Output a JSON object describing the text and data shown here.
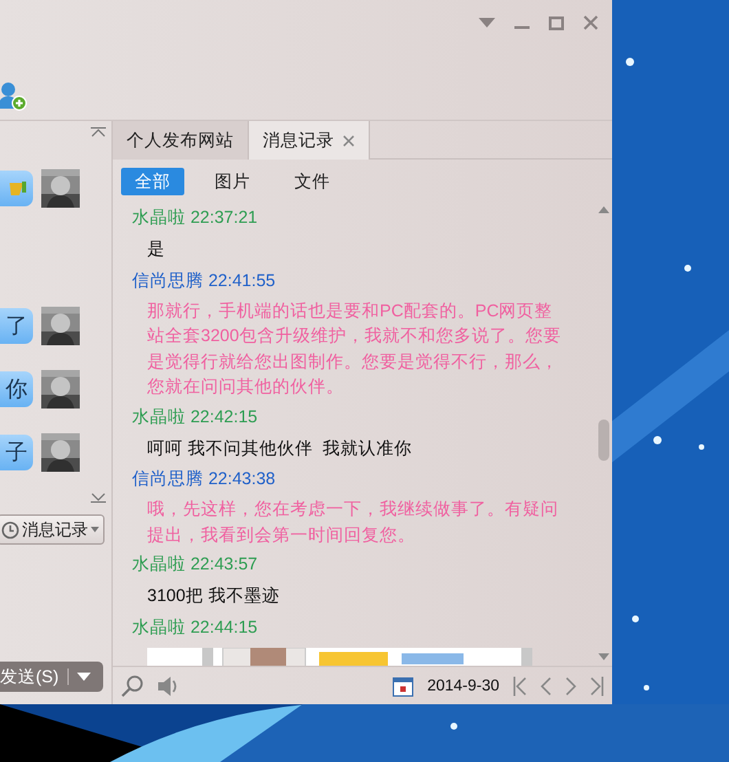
{
  "left_panel": {
    "bubbles": [
      {
        "kind": "icon"
      },
      {
        "kind": "text",
        "text": "了"
      },
      {
        "kind": "text",
        "text": "你"
      },
      {
        "kind": "text",
        "text": "子"
      }
    ],
    "history_button": "消息记录",
    "send_button": "发送(S)"
  },
  "tabs": [
    {
      "label": "个人发布网站",
      "selected": false,
      "closable": false
    },
    {
      "label": "消息记录",
      "selected": true,
      "closable": true
    }
  ],
  "filters": [
    {
      "label": "全部",
      "selected": true
    },
    {
      "label": "图片",
      "selected": false
    },
    {
      "label": "文件",
      "selected": false
    }
  ],
  "messages": [
    {
      "sender": "水晶啦",
      "time": "22:37:21",
      "kind": "self",
      "text": "是"
    },
    {
      "sender": "信尚思腾",
      "time": "22:41:55",
      "kind": "peer",
      "text": "那就行，手机端的话也是要和PC配套的。PC网页整站全套3200包含升级维护，我就不和您多说了。您要是觉得行就给您出图制作。您要是觉得不行，那么，您就在问问其他的伙伴。"
    },
    {
      "sender": "水晶啦",
      "time": "22:42:15",
      "kind": "self",
      "text": "呵呵 我不问其他伙伴  我就认准你"
    },
    {
      "sender": "信尚思腾",
      "time": "22:43:38",
      "kind": "peer",
      "text": "哦，先这样，您在考虑一下，我继续做事了。有疑问提出，我看到会第一时间回复您。"
    },
    {
      "sender": "水晶啦",
      "time": "22:43:57",
      "kind": "self",
      "text": "3100把 我不墨迹"
    },
    {
      "sender": "水晶啦",
      "time": "22:44:15",
      "kind": "self"
    }
  ],
  "footer": {
    "date": "2014-9-30"
  }
}
